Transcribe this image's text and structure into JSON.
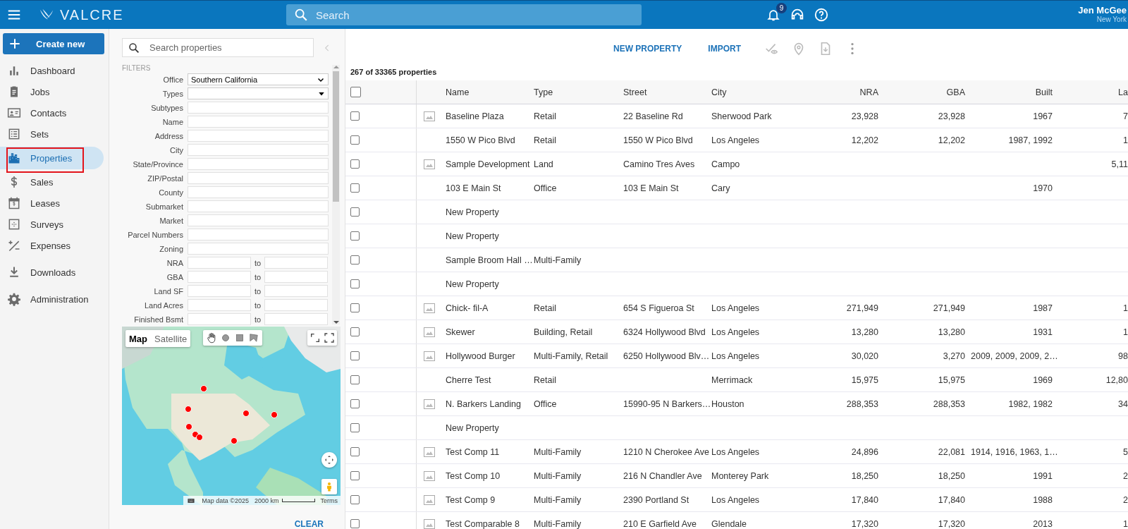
{
  "header": {
    "logo": "VALCRE",
    "search_placeholder": "Search",
    "notifications": "9",
    "user_name": "Jen McGee",
    "user_location": "New York"
  },
  "nav": {
    "create_button": "Create new",
    "sections": [
      [
        {
          "label": "Dashboard",
          "selected": false,
          "outlined": false
        },
        {
          "label": "Jobs",
          "selected": false,
          "outlined": false
        },
        {
          "label": "Contacts",
          "selected": false,
          "outlined": false
        },
        {
          "label": "Sets",
          "selected": false,
          "outlined": false
        },
        {
          "label": "Properties",
          "selected": true,
          "outlined": true
        },
        {
          "label": "Sales",
          "selected": false,
          "outlined": false
        },
        {
          "label": "Leases",
          "selected": false,
          "outlined": false
        },
        {
          "label": "Surveys",
          "selected": false,
          "outlined": false
        },
        {
          "label": "Expenses",
          "selected": false,
          "outlined": false
        }
      ],
      [
        {
          "label": "Downloads",
          "selected": false,
          "outlined": false
        }
      ],
      [
        {
          "label": "Administration",
          "selected": false,
          "outlined": false
        }
      ]
    ]
  },
  "filters": {
    "search_placeholder": "Search properties",
    "heading": "FILTERS",
    "fields": [
      {
        "label": "Office",
        "kind": "select",
        "value": "Southern California"
      },
      {
        "label": "Types",
        "kind": "multiselect"
      },
      {
        "label": "Subtypes",
        "kind": "text"
      },
      {
        "label": "Name",
        "kind": "text"
      },
      {
        "label": "Address",
        "kind": "text"
      },
      {
        "label": "City",
        "kind": "text"
      },
      {
        "label": "State/Province",
        "kind": "text"
      },
      {
        "label": "ZIP/Postal",
        "kind": "text"
      },
      {
        "label": "County",
        "kind": "text"
      },
      {
        "label": "Submarket",
        "kind": "text"
      },
      {
        "label": "Market",
        "kind": "text"
      },
      {
        "label": "Parcel Numbers",
        "kind": "text"
      },
      {
        "label": "Zoning",
        "kind": "text"
      },
      {
        "label": "NRA",
        "kind": "range",
        "separator": "to"
      },
      {
        "label": "GBA",
        "kind": "range",
        "separator": "to"
      },
      {
        "label": "Land SF",
        "kind": "range",
        "separator": "to"
      },
      {
        "label": "Land Acres",
        "kind": "range",
        "separator": "to"
      },
      {
        "label": "Finished Bsmt",
        "kind": "range",
        "separator": "to"
      }
    ],
    "map": {
      "kind": "picture",
      "tabs": [
        {
          "label": "Map",
          "selected": true
        },
        {
          "label": "Satellite",
          "selected": false
        }
      ],
      "attribution": "Map data ©2025",
      "scale": "2000 km",
      "terms": "Terms"
    },
    "clear_button": "CLEAR"
  },
  "toolbar": {
    "actions": [
      "NEW PROPERTY",
      "IMPORT"
    ],
    "count": "267 of 33365 properties"
  },
  "table": {
    "all_checked": false,
    "columns": [
      "Name",
      "Type",
      "Street",
      "City",
      "NRA",
      "GBA",
      "Built",
      "La"
    ],
    "rows": [
      {
        "checked": false,
        "has_image": true,
        "cells": [
          "Baseline Plaza",
          "Retail",
          "22 Baseline Rd",
          "Sherwood Park",
          "23,928",
          "23,928",
          "1967",
          "7"
        ]
      },
      {
        "checked": false,
        "has_image": false,
        "cells": [
          "1550 W Pico Blvd",
          "Retail",
          "1550 W Pico Blvd",
          "Los Angeles",
          "12,202",
          "12,202",
          "1987, 1992",
          "1"
        ]
      },
      {
        "checked": false,
        "has_image": true,
        "cells": [
          "Sample Development",
          "Land",
          "Camino Tres Aves",
          "Campo",
          null,
          null,
          null,
          "5,11"
        ]
      },
      {
        "checked": false,
        "has_image": false,
        "cells": [
          "103 E Main St",
          "Office",
          "103 E Main St",
          "Cary",
          null,
          null,
          "1970",
          null
        ]
      },
      {
        "checked": false,
        "has_image": false,
        "cells": [
          "New Property",
          null,
          null,
          null,
          null,
          null,
          null,
          null
        ]
      },
      {
        "checked": false,
        "has_image": false,
        "cells": [
          "New Property",
          null,
          null,
          null,
          null,
          null,
          null,
          null
        ]
      },
      {
        "checked": false,
        "has_image": false,
        "cells": [
          "Sample Broom Hall …",
          "Multi-Family",
          null,
          null,
          null,
          null,
          null,
          null
        ]
      },
      {
        "checked": false,
        "has_image": false,
        "cells": [
          "New Property",
          null,
          null,
          null,
          null,
          null,
          null,
          null
        ]
      },
      {
        "checked": false,
        "has_image": true,
        "cells": [
          "Chick- fil-A",
          "Retail",
          "654 S Figueroa St",
          "Los Angeles",
          "271,949",
          "271,949",
          "1987",
          "1"
        ]
      },
      {
        "checked": false,
        "has_image": true,
        "cells": [
          "Skewer",
          "Building, Retail",
          "6324 Hollywood Blvd",
          "Los Angeles",
          "13,280",
          "13,280",
          "1931",
          "1"
        ]
      },
      {
        "checked": false,
        "has_image": true,
        "cells": [
          "Hollywood Burger",
          "Multi-Family, Retail",
          "6250 Hollywood Blv…",
          "Los Angeles",
          "30,020",
          "3,270",
          "2009, 2009, 2009, 2…",
          "98"
        ]
      },
      {
        "checked": false,
        "has_image": false,
        "cells": [
          "Cherre Test",
          "Retail",
          null,
          "Merrimack",
          "15,975",
          "15,975",
          "1969",
          "12,80"
        ]
      },
      {
        "checked": false,
        "has_image": true,
        "cells": [
          "N. Barkers Landing",
          "Office",
          "15990-95 N Barkers…",
          "Houston",
          "288,353",
          "288,353",
          "1982, 1982",
          "34"
        ]
      },
      {
        "checked": false,
        "has_image": false,
        "cells": [
          "New Property",
          null,
          null,
          null,
          null,
          null,
          null,
          null
        ]
      },
      {
        "checked": false,
        "has_image": true,
        "cells": [
          "Test Comp 11",
          "Multi-Family",
          "1210 N Cherokee Ave",
          "Los Angeles",
          "24,896",
          "22,081",
          "1914, 1916, 1963, 1…",
          "5"
        ]
      },
      {
        "checked": false,
        "has_image": true,
        "cells": [
          "Test Comp 10",
          "Multi-Family",
          "216 N Chandler Ave",
          "Monterey Park",
          "18,250",
          "18,250",
          "1991",
          "2"
        ]
      },
      {
        "checked": false,
        "has_image": true,
        "cells": [
          "Test Comp 9",
          "Multi-Family",
          "2390 Portland St",
          "Los Angeles",
          "17,840",
          "17,840",
          "1988",
          "2"
        ]
      },
      {
        "checked": false,
        "has_image": true,
        "cells": [
          "Test Comparable 8",
          "Multi-Family",
          "210 E Garfield Ave",
          "Glendale",
          "17,320",
          "17,320",
          "2013",
          "1"
        ]
      }
    ]
  }
}
